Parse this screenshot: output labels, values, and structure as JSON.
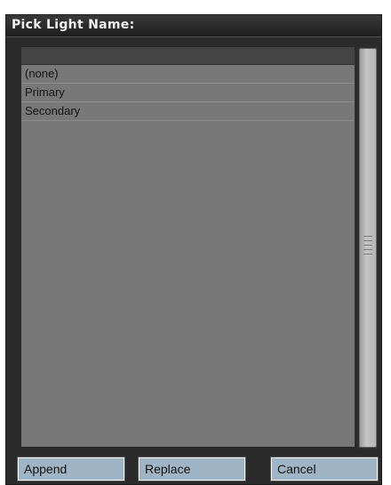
{
  "dialog": {
    "title": "Pick Light Name:"
  },
  "list": {
    "items": [
      "(none)",
      "Primary",
      "Secondary"
    ]
  },
  "buttons": {
    "append": "Append",
    "replace": "Replace",
    "cancel": "Cancel"
  },
  "colors": {
    "window_bg": "#2b2b2b",
    "list_bg": "#787878",
    "list_header": "#444444",
    "button_bg": "#9fb4c4"
  }
}
